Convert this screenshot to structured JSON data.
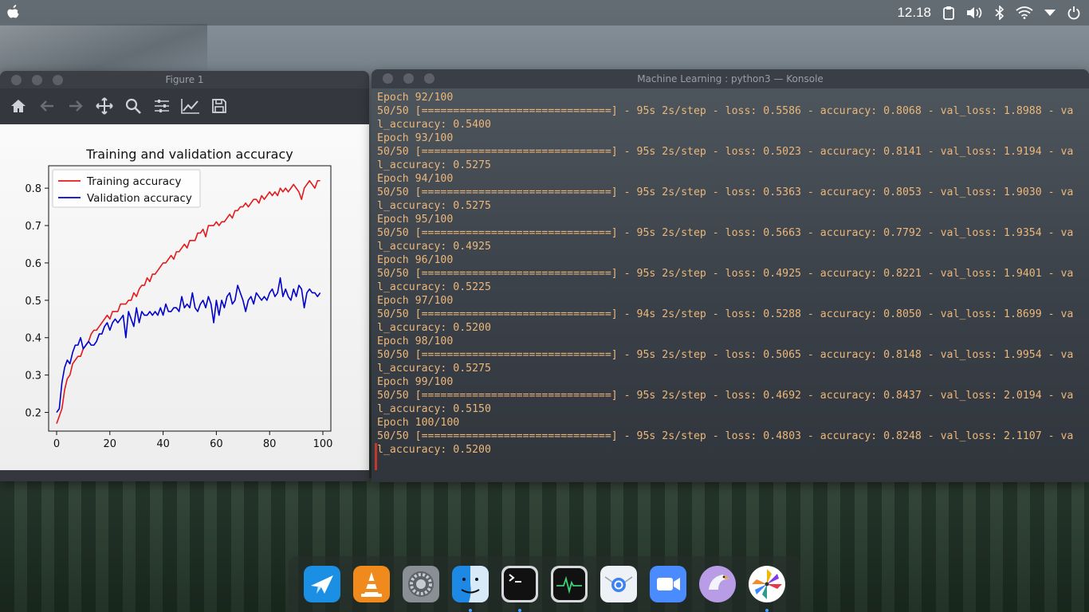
{
  "menubar": {
    "clock": "12.18",
    "icons": [
      "apple-icon",
      "clipboard-icon",
      "volume-icon",
      "bluetooth-icon",
      "wifi-icon",
      "dropdown-icon",
      "power-icon"
    ]
  },
  "figure_window": {
    "title": "Figure 1",
    "toolbar": [
      "home-icon",
      "back-icon",
      "forward-icon",
      "pan-icon",
      "zoom-icon",
      "configure-subplots-icon",
      "edit-axis-icon",
      "save-icon"
    ]
  },
  "chart_data": {
    "type": "line",
    "title": "Training and validation accuracy",
    "xlabel": "",
    "ylabel": "",
    "xlim": [
      -3,
      103
    ],
    "ylim": [
      0.15,
      0.86
    ],
    "xticks": [
      "0",
      "20",
      "40",
      "60",
      "80",
      "100"
    ],
    "yticks": [
      "0.2",
      "0.3",
      "0.4",
      "0.5",
      "0.6",
      "0.7",
      "0.8"
    ],
    "legend_position": "top-left",
    "grid": false,
    "series": [
      {
        "name": "Training accuracy",
        "color": "#e41a1c",
        "x": [
          0,
          1,
          2,
          3,
          4,
          5,
          6,
          7,
          8,
          9,
          10,
          11,
          12,
          13,
          14,
          15,
          16,
          17,
          18,
          19,
          20,
          21,
          22,
          23,
          24,
          25,
          26,
          27,
          28,
          29,
          30,
          31,
          32,
          33,
          34,
          35,
          36,
          37,
          38,
          39,
          40,
          41,
          42,
          43,
          44,
          45,
          46,
          47,
          48,
          49,
          50,
          51,
          52,
          53,
          54,
          55,
          56,
          57,
          58,
          59,
          60,
          61,
          62,
          63,
          64,
          65,
          66,
          67,
          68,
          69,
          70,
          71,
          72,
          73,
          74,
          75,
          76,
          77,
          78,
          79,
          80,
          81,
          82,
          83,
          84,
          85,
          86,
          87,
          88,
          89,
          90,
          91,
          92,
          93,
          94,
          95,
          96,
          97,
          98,
          99
        ],
        "values": [
          0.17,
          0.19,
          0.21,
          0.26,
          0.29,
          0.3,
          0.33,
          0.34,
          0.35,
          0.35,
          0.37,
          0.38,
          0.39,
          0.41,
          0.42,
          0.42,
          0.43,
          0.44,
          0.45,
          0.46,
          0.45,
          0.47,
          0.47,
          0.47,
          0.49,
          0.49,
          0.49,
          0.5,
          0.5,
          0.52,
          0.51,
          0.53,
          0.54,
          0.54,
          0.56,
          0.55,
          0.57,
          0.57,
          0.58,
          0.59,
          0.6,
          0.6,
          0.61,
          0.62,
          0.61,
          0.63,
          0.63,
          0.64,
          0.65,
          0.64,
          0.66,
          0.66,
          0.66,
          0.68,
          0.68,
          0.69,
          0.67,
          0.7,
          0.7,
          0.7,
          0.71,
          0.7,
          0.71,
          0.71,
          0.72,
          0.73,
          0.72,
          0.74,
          0.74,
          0.75,
          0.75,
          0.76,
          0.75,
          0.76,
          0.77,
          0.77,
          0.76,
          0.78,
          0.77,
          0.78,
          0.79,
          0.78,
          0.79,
          0.78,
          0.8,
          0.79,
          0.8,
          0.79,
          0.8,
          0.81,
          0.8,
          0.79,
          0.77,
          0.8,
          0.81,
          0.82,
          0.81,
          0.8,
          0.82,
          0.82
        ]
      },
      {
        "name": "Validation accuracy",
        "color": "#0000cd",
        "x": [
          0,
          1,
          2,
          3,
          4,
          5,
          6,
          7,
          8,
          9,
          10,
          11,
          12,
          13,
          14,
          15,
          16,
          17,
          18,
          19,
          20,
          21,
          22,
          23,
          24,
          25,
          26,
          27,
          28,
          29,
          30,
          31,
          32,
          33,
          34,
          35,
          36,
          37,
          38,
          39,
          40,
          41,
          42,
          43,
          44,
          45,
          46,
          47,
          48,
          49,
          50,
          51,
          52,
          53,
          54,
          55,
          56,
          57,
          58,
          59,
          60,
          61,
          62,
          63,
          64,
          65,
          66,
          67,
          68,
          69,
          70,
          71,
          72,
          73,
          74,
          75,
          76,
          77,
          78,
          79,
          80,
          81,
          82,
          83,
          84,
          85,
          86,
          87,
          88,
          89,
          90,
          91,
          92,
          93,
          94,
          95,
          96,
          97,
          98,
          99
        ],
        "values": [
          0.2,
          0.21,
          0.28,
          0.32,
          0.34,
          0.33,
          0.36,
          0.38,
          0.38,
          0.4,
          0.37,
          0.38,
          0.39,
          0.38,
          0.38,
          0.39,
          0.41,
          0.41,
          0.43,
          0.44,
          0.42,
          0.44,
          0.45,
          0.44,
          0.45,
          0.46,
          0.4,
          0.47,
          0.45,
          0.43,
          0.48,
          0.44,
          0.47,
          0.46,
          0.46,
          0.47,
          0.46,
          0.47,
          0.46,
          0.48,
          0.46,
          0.49,
          0.47,
          0.47,
          0.48,
          0.48,
          0.47,
          0.51,
          0.48,
          0.49,
          0.48,
          0.52,
          0.48,
          0.47,
          0.49,
          0.5,
          0.48,
          0.51,
          0.49,
          0.44,
          0.5,
          0.46,
          0.5,
          0.48,
          0.51,
          0.52,
          0.49,
          0.5,
          0.54,
          0.52,
          0.5,
          0.47,
          0.5,
          0.51,
          0.49,
          0.52,
          0.51,
          0.5,
          0.51,
          0.5,
          0.52,
          0.53,
          0.51,
          0.52,
          0.56,
          0.51,
          0.53,
          0.51,
          0.5,
          0.53,
          0.51,
          0.54,
          0.53,
          0.48,
          0.52,
          0.53,
          0.52,
          0.52,
          0.51,
          0.52
        ]
      }
    ]
  },
  "konsole": {
    "title": "Machine Learning : python3 — Konsole",
    "lines": [
      "Epoch 92/100",
      "50/50 [==============================] - 95s 2s/step - loss: 0.5586 - accuracy: 0.8068 - val_loss: 1.8988 - va",
      "l_accuracy: 0.5400",
      "Epoch 93/100",
      "50/50 [==============================] - 95s 2s/step - loss: 0.5023 - accuracy: 0.8141 - val_loss: 1.9194 - va",
      "l_accuracy: 0.5275",
      "Epoch 94/100",
      "50/50 [==============================] - 95s 2s/step - loss: 0.5363 - accuracy: 0.8053 - val_loss: 1.9030 - va",
      "l_accuracy: 0.5275",
      "Epoch 95/100",
      "50/50 [==============================] - 95s 2s/step - loss: 0.5663 - accuracy: 0.7792 - val_loss: 1.9354 - va",
      "l_accuracy: 0.4925",
      "Epoch 96/100",
      "50/50 [==============================] - 95s 2s/step - loss: 0.4925 - accuracy: 0.8221 - val_loss: 1.9401 - va",
      "l_accuracy: 0.5225",
      "Epoch 97/100",
      "50/50 [==============================] - 94s 2s/step - loss: 0.5288 - accuracy: 0.8050 - val_loss: 1.8699 - va",
      "l_accuracy: 0.5200",
      "Epoch 98/100",
      "50/50 [==============================] - 95s 2s/step - loss: 0.5065 - accuracy: 0.8148 - val_loss: 1.9954 - va",
      "l_accuracy: 0.5275",
      "Epoch 99/100",
      "50/50 [==============================] - 95s 2s/step - loss: 0.4692 - accuracy: 0.8437 - val_loss: 2.0194 - va",
      "l_accuracy: 0.5150",
      "Epoch 100/100",
      "50/50 [==============================] - 95s 2s/step - loss: 0.4803 - accuracy: 0.8248 - val_loss: 2.1107 - va",
      "l_accuracy: 0.5200"
    ]
  },
  "dock": {
    "items": [
      {
        "icon": "kite-app-icon",
        "running": false
      },
      {
        "icon": "vlc-icon",
        "running": false
      },
      {
        "icon": "system-settings-icon",
        "running": false
      },
      {
        "icon": "finder-icon",
        "running": true
      },
      {
        "icon": "terminal-icon",
        "running": true
      },
      {
        "icon": "activity-monitor-icon",
        "running": false
      },
      {
        "icon": "mail-icon",
        "running": false
      },
      {
        "icon": "zoom-icon",
        "running": false
      },
      {
        "icon": "eagle-icon",
        "running": false
      },
      {
        "icon": "pinwheel-icon",
        "running": true
      }
    ]
  }
}
